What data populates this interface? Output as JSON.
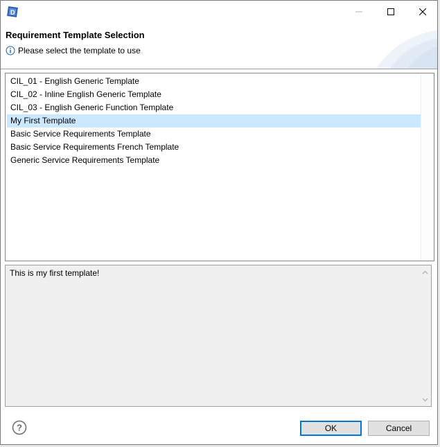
{
  "window": {
    "icon": "app-logo-icon",
    "controls": {
      "minimize": "minimize-icon",
      "maximize": "maximize-icon",
      "close": "close-icon"
    }
  },
  "header": {
    "title": "Requirement Template Selection",
    "message": "Please select the template to use",
    "message_icon": "info-icon"
  },
  "templates": [
    "CIL_01 - English Generic Template",
    "CIL_02 - Inline English Generic Template",
    "CIL_03 - English Generic Function Template",
    "My First Template",
    "Basic Service Requirements Template",
    "Basic Service Requirements French Template",
    "Generic Service Requirements Template"
  ],
  "selected_template": "My First Template",
  "description": "This is my first template!",
  "footer": {
    "help_icon": "help-icon",
    "ok_label": "OK",
    "cancel_label": "Cancel"
  },
  "colors": {
    "selection": "#cce8ff",
    "default_button_border": "#0078d7",
    "info_icon": "#1a5fb4"
  }
}
